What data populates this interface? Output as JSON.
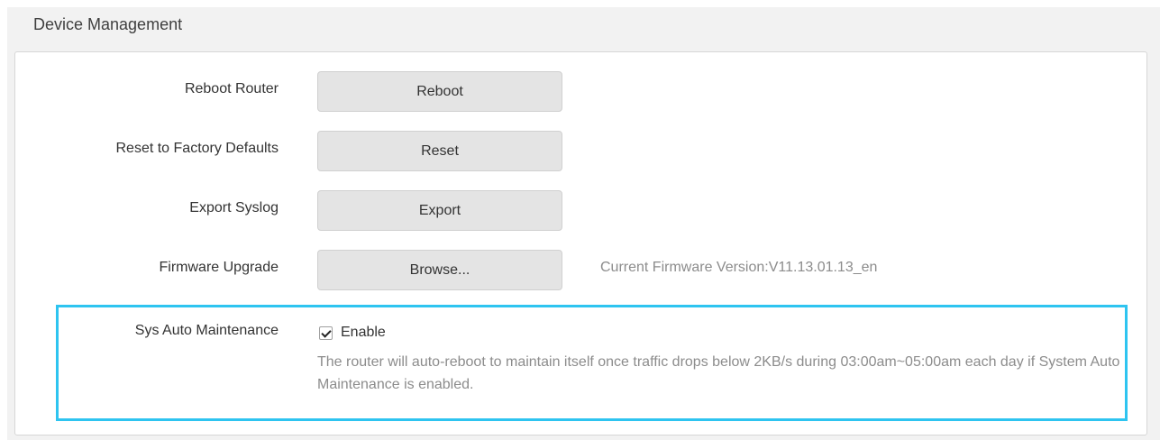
{
  "section": {
    "title": "Device Management"
  },
  "rows": {
    "reboot": {
      "label": "Reboot Router",
      "button": "Reboot"
    },
    "reset": {
      "label": "Reset to Factory Defaults",
      "button": "Reset"
    },
    "export": {
      "label": "Export Syslog",
      "button": "Export"
    },
    "firmware": {
      "label": "Firmware Upgrade",
      "button": "Browse...",
      "version_text": "Current Firmware Version:V11.13.01.13_en"
    },
    "auto_maintenance": {
      "label": "Sys Auto Maintenance",
      "checkbox_label": "Enable",
      "checked": true,
      "description": "The router will auto-reboot to maintain itself once traffic drops below 2KB/s during 03:00am~05:00am each day if System Auto Maintenance is enabled."
    }
  },
  "colors": {
    "highlight": "#2ec4f0",
    "button_bg": "#e4e4e4",
    "hint_text": "#8c8c8c"
  }
}
